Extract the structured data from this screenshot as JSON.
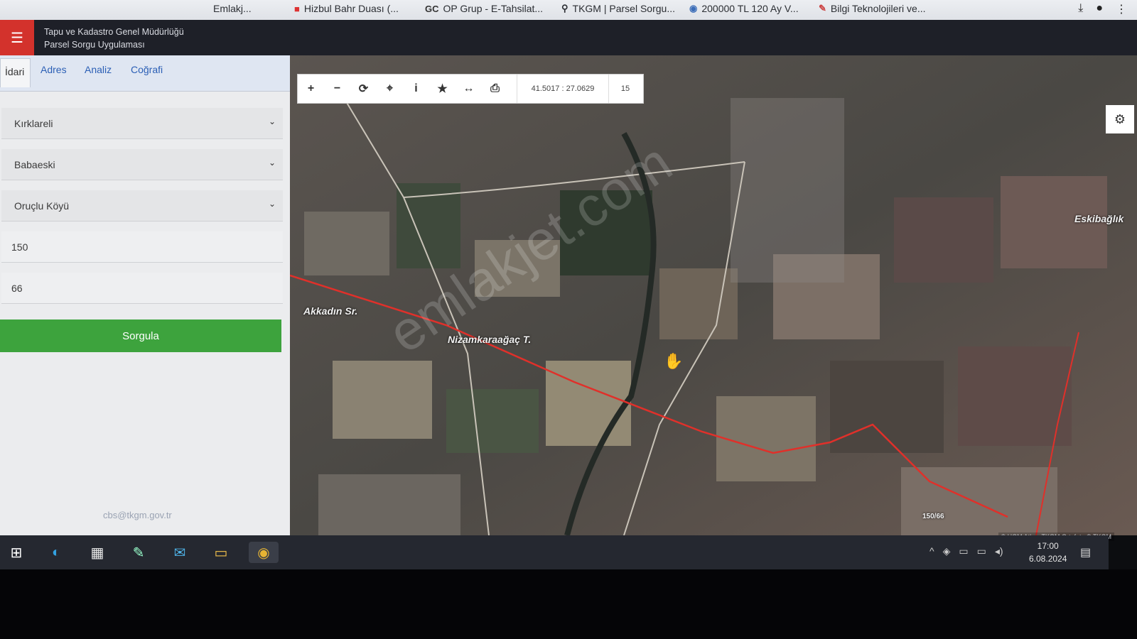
{
  "bookmarks": [
    {
      "icon": "",
      "label": "Emlakj..."
    },
    {
      "icon": "■",
      "label": "Hizbul Bahr Duası (..."
    },
    {
      "icon": "GC",
      "label": "OP Grup - E-Tahsilat..."
    },
    {
      "icon": "⚲",
      "label": "TKGM | Parsel Sorgu..."
    },
    {
      "icon": "◉",
      "label": "200000 TL 120 Ay V..."
    },
    {
      "icon": "✎",
      "label": "Bilgi Teknolojileri ve..."
    }
  ],
  "header": {
    "title_line1": "Tapu ve Kadastro Genel Müdürlüğü",
    "title_line2": "Parsel Sorgu Uygulaması",
    "menu_icon": "☰"
  },
  "tabs": [
    "İdari",
    "Adres",
    "Analiz",
    "Coğrafi"
  ],
  "form": {
    "province": "Kırklareli",
    "district": "Babaeski",
    "neighborhood": "Oruçlu Köyü",
    "block": "150",
    "parcel": "66",
    "submit_label": "Sorgula"
  },
  "footer_email": "cbs@tkgm.gov.tr",
  "map": {
    "toolbar": [
      "+",
      "−",
      "⟳",
      "⌖",
      "i",
      "★",
      "↔",
      "⎙"
    ],
    "coords": "41.5017 : 27.0629",
    "zoom": "15",
    "labels": {
      "akkadin": "Akkadın Sr.",
      "nizam": "Nizamkaraağaç T.",
      "eski": "Eskibağlık",
      "parcel_tag": "150/66"
    },
    "attribution": "© HGM Atlas, TKGM Ortofoto © TKGM",
    "watermark": "emlakjet.com",
    "boundary_color": "#e0302a"
  },
  "taskbar": {
    "time": "17:00",
    "date": "6.08.2024"
  }
}
